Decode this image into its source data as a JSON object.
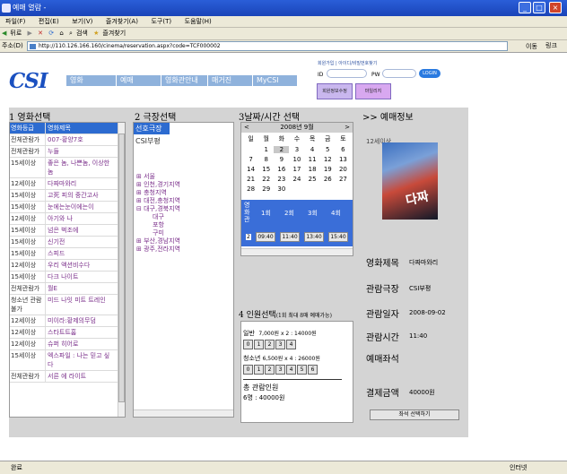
{
  "window": {
    "title": "예매 열람 -"
  },
  "menu": [
    "파일(F)",
    "편집(E)",
    "보기(V)",
    "즐겨찾기(A)",
    "도구(T)",
    "도움말(H)"
  ],
  "toolbar": {
    "back": "뒤로",
    "search": "검색",
    "favorites": "즐겨찾기"
  },
  "address": {
    "label": "주소(D)",
    "url": "http://110.126.166.160/cinema/reservation.aspx?code=TCF000002",
    "go": "이동",
    "links": "링크"
  },
  "logo": {
    "text": "CSI"
  },
  "nav": [
    "영화",
    "예매",
    "영화관안내",
    "매거진",
    "MyCSI"
  ],
  "login": {
    "links": "회원가입 | 아이디/비밀번호찾기",
    "id_label": "ID",
    "pw_label": "PW",
    "button": "LOGIN",
    "svc_a": "회원정보수정",
    "svc_b": "마일리지"
  },
  "sections": {
    "movie": "1 영화선택",
    "theater": "2 극장선택",
    "datetime": "3날짜/시간 선택",
    "info": ">> 예매정보",
    "people": "4 인원선택",
    "people_note": "(1회 최대 8매 예매가능)"
  },
  "movies": {
    "headers": [
      "영화등급",
      "영화제목"
    ],
    "rows": [
      [
        "전체관람가",
        "007-황양7호"
      ],
      [
        "전체관람가",
        "누들"
      ],
      [
        "15세이상",
        "좋은 놈, 나쁜놈, 이상한놈"
      ],
      [
        "12세이상",
        "다짜마와리"
      ],
      [
        "15세이상",
        "고死 피의 중간고사"
      ],
      [
        "15세이상",
        "눈에는눈이에는이"
      ],
      [
        "12세이상",
        "아기와 나"
      ],
      [
        "15세이상",
        "넘은 벅조에"
      ],
      [
        "15세이상",
        "신기전"
      ],
      [
        "15세이상",
        "스피드"
      ],
      [
        "12세이상",
        "우리 액션비수다"
      ],
      [
        "15세이상",
        "다크 나이트"
      ],
      [
        "전체관람가",
        "월E"
      ],
      [
        "청소년 관람불가",
        "미드 나잇 미트 트레인"
      ],
      [
        "12세이상",
        "미이라:황제의무덤"
      ],
      [
        "12세이상",
        "스타트트홈"
      ],
      [
        "12세이상",
        "슈퍼 히어로"
      ],
      [
        "15세이상",
        "엑스파일 : 나는 믿고 싶다"
      ],
      [
        "전체관람가",
        "서른 에 라이트"
      ]
    ]
  },
  "theater": {
    "header": "선호극장",
    "items": [
      "CSI부평"
    ],
    "regions": [
      "서울",
      "인천,경기지역",
      "충청지역",
      "대전,충청지역",
      "대구,경북지역"
    ],
    "sub": [
      "대구",
      "포항",
      "구미"
    ],
    "regions2": [
      "부산,경남지역",
      "광주,전라지역"
    ]
  },
  "calendar": {
    "prev": "<",
    "month": "2008년 9월",
    "next": ">",
    "weekdays": [
      "일",
      "월",
      "화",
      "수",
      "목",
      "금",
      "토"
    ],
    "days": [
      "",
      "1",
      "2",
      "3",
      "4",
      "5",
      "6",
      "7",
      "8",
      "9",
      "10",
      "11",
      "12",
      "13",
      "14",
      "15",
      "16",
      "17",
      "18",
      "19",
      "20",
      "21",
      "22",
      "23",
      "24",
      "25",
      "26",
      "27",
      "28",
      "29",
      "30",
      "",
      "",
      "",
      ""
    ],
    "selected": "2"
  },
  "times": {
    "theater_col": "영화관",
    "rounds": [
      "1회",
      "2회",
      "3회",
      "4회"
    ],
    "screen": "2",
    "slots": [
      "09:40",
      "11:40",
      "13:40",
      "15:40"
    ]
  },
  "people": {
    "adult_label": "일반",
    "adult_price": "7,000원 x 2 : 14000원",
    "adult_btns": [
      "0",
      "1",
      "2",
      "3",
      "4"
    ],
    "teen_label": "청소년",
    "teen_price": "6,500원 x 4 : 26000원",
    "teen_btns": [
      "0",
      "1",
      "2",
      "3",
      "4",
      "5",
      "6"
    ],
    "total_label": "총 관람인원",
    "total_value": "6명 : 40000원"
  },
  "info": {
    "age": "12세이상",
    "poster_text": "다짜",
    "movie_label": "영화제목",
    "movie_value": "다짜마와리",
    "theater_label": "관람극장",
    "theater_value": "CSI부평",
    "date_label": "관람일자",
    "date_value": "2008-09-02",
    "time_label": "관람시간",
    "time_value": "11:40",
    "seat_label": "예매좌석",
    "pay_label": "결제금액",
    "pay_value": "40000원",
    "select_btn": "좌석 선택하기"
  },
  "status": {
    "left": "완료",
    "right": "인터넷"
  },
  "colors": {
    "accent": "#2c6bd0",
    "nav": "#8fb2dc"
  }
}
